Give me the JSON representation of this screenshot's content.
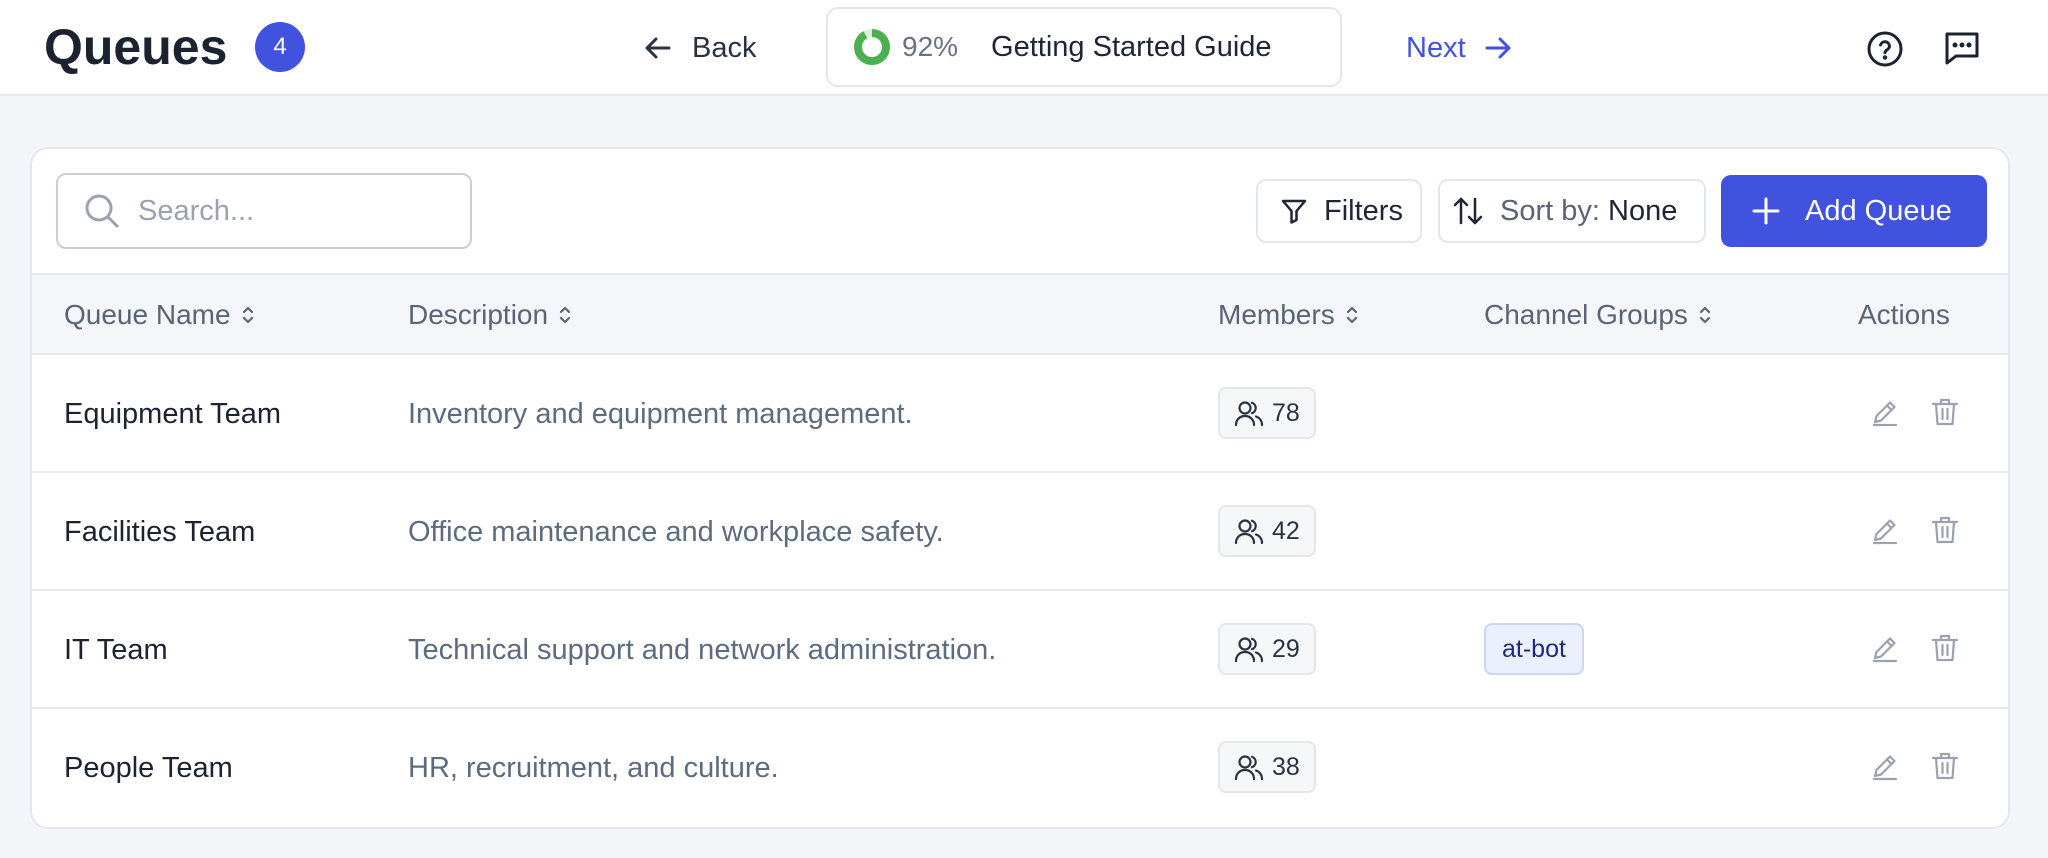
{
  "header": {
    "title": "Queues",
    "count": "4",
    "back_label": "Back",
    "guide": {
      "progress_percent": 92,
      "progress_label": "92%",
      "title": "Getting Started Guide"
    },
    "next_label": "Next"
  },
  "toolbar": {
    "search_placeholder": "Search...",
    "filters_label": "Filters",
    "sort_prefix": "Sort by:",
    "sort_value": "None",
    "add_label": "Add Queue"
  },
  "table": {
    "columns": [
      "Queue Name",
      "Description",
      "Members",
      "Channel Groups",
      "Actions"
    ],
    "rows": [
      {
        "name": "Equipment Team",
        "description": "Inventory and equipment management.",
        "members": "78",
        "channel_groups": []
      },
      {
        "name": "Facilities Team",
        "description": "Office maintenance and workplace safety.",
        "members": "42",
        "channel_groups": []
      },
      {
        "name": "IT Team",
        "description": "Technical support and network administration.",
        "members": "29",
        "channel_groups": [
          "at-bot"
        ]
      },
      {
        "name": "People Team",
        "description": "HR, recruitment, and culture.",
        "members": "38",
        "channel_groups": []
      }
    ]
  },
  "colors": {
    "accent": "#4152df",
    "progress": "#4caf50",
    "background": "#f4f5f8"
  },
  "icons": {
    "back": "arrow-left-icon",
    "next": "arrow-right-icon",
    "help": "question-circle-icon",
    "chat": "chat-bubble-icon",
    "search": "search-icon",
    "filter": "filter-icon",
    "sort": "sort-arrows-icon",
    "add": "plus-icon",
    "members": "users-icon",
    "edit": "pencil-icon",
    "delete": "trash-icon"
  }
}
